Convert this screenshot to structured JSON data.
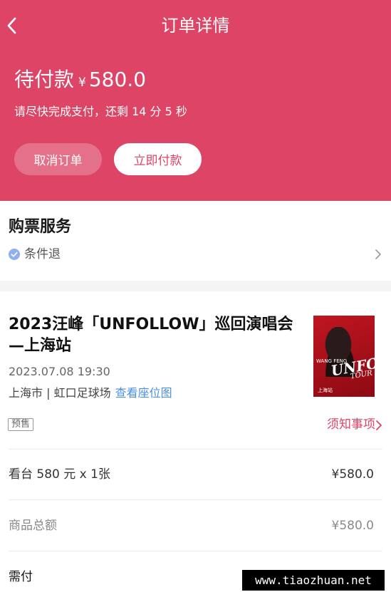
{
  "nav": {
    "title": "订单详情"
  },
  "order_status": {
    "status": "待付款",
    "currency": "¥",
    "amount": "580.0",
    "countdown": "请尽快完成支付，还剩 14 分 5 秒"
  },
  "actions": {
    "cancel_label": "取消订单",
    "pay_label": "立即付款"
  },
  "service": {
    "title": "购票服务",
    "item_label": "条件退"
  },
  "event": {
    "title": "2023汪峰「UNFOLLOW」巡回演唱会—上海站",
    "datetime": "2023.07.08 19:30",
    "venue": "上海市 | 虹口足球场",
    "seat_map_link": "查看座位图",
    "sale_tag": "预售",
    "notes_link": "须知事项",
    "poster": {
      "artist": "WANG FENG",
      "main": "UNFOLLOW",
      "sub": "TOUR",
      "city": "上海站"
    }
  },
  "order_lines": {
    "ticket_label": "看台 580 元 x 1张",
    "ticket_price": "¥580.0",
    "total_label": "商品总额",
    "total_price": "¥580.0",
    "payable_label": "需付"
  },
  "watermark": "www.tiaozhuan.net",
  "colors": {
    "brand": "#dd4466",
    "link": "#4a90e2",
    "check": "#8fb0f0"
  }
}
